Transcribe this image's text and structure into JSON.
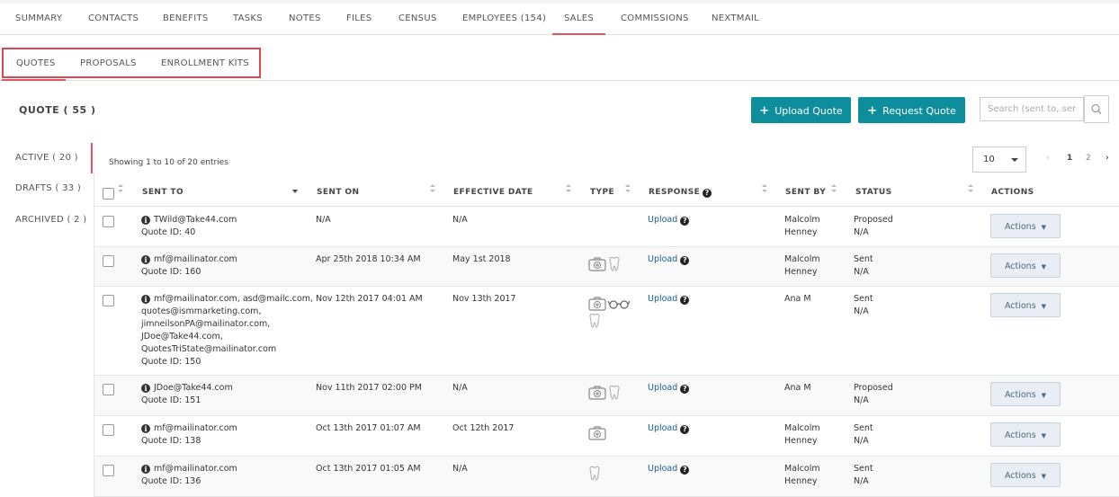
{
  "top_tabs": [
    {
      "label": "SUMMARY"
    },
    {
      "label": "CONTACTS"
    },
    {
      "label": "BENEFITS"
    },
    {
      "label": "TASKS"
    },
    {
      "label": "NOTES"
    },
    {
      "label": "FILES"
    },
    {
      "label": "CENSUS"
    },
    {
      "label": "EMPLOYEES (154)"
    },
    {
      "label": "SALES"
    },
    {
      "label": "COMMISSIONS"
    },
    {
      "label": "NEXTMAIL"
    }
  ],
  "sub_tabs": [
    {
      "label": "QUOTES"
    },
    {
      "label": "PROPOSALS"
    },
    {
      "label": "ENROLLMENT KITS"
    }
  ],
  "quote_title": "QUOTE ( 55 )",
  "upload_quote_label": "Upload Quote",
  "request_quote_label": "Request Quote",
  "search_placeholder": "Search (sent to, ser",
  "sidebar": [
    {
      "label": "ACTIVE ( 20 )"
    },
    {
      "label": "DRAFTS ( 33 )"
    },
    {
      "label": "ARCHIVED ( 2 )"
    }
  ],
  "showing_text": "Showing 1 to 10 of 20 entries",
  "page_size": "10",
  "pages": [
    "1",
    "2"
  ],
  "accent_color": "#0e8d9c",
  "columns": {
    "sent_to": "SENT TO",
    "sent_on": "SENT ON",
    "effective_date": "EFFECTIVE DATE",
    "type": "TYPE",
    "response": "RESPONSE",
    "sent_by": "SENT BY",
    "status": "STATUS",
    "actions": "ACTIONS"
  },
  "actions_label": "Actions",
  "rows": [
    {
      "sent_to": [
        "TWild@Take44.com"
      ],
      "quote_id": "Quote ID: 40",
      "sent_on": "N/A",
      "effective_date": "N/A",
      "type_icons": [],
      "response": "Upload",
      "sent_by": [
        "Malcolm",
        "Henney"
      ],
      "status": "Proposed",
      "status_sub": "N/A"
    },
    {
      "sent_to": [
        "mf@mailinator.com"
      ],
      "quote_id": "Quote ID: 160",
      "sent_on": "Apr 25th 2018 10:34 AM",
      "effective_date": "May 1st 2018",
      "type_icons": [
        "medical-icon",
        "dental-icon"
      ],
      "response": "Upload",
      "sent_by": [
        "Malcolm",
        "Henney"
      ],
      "status": "Sent",
      "status_sub": "N/A"
    },
    {
      "sent_to": [
        "mf@mailinator.com, asd@mailc.com,",
        "quotes@ismmarketing.com,",
        "jimneilsonPA@mailinator.com,",
        "JDoe@Take44.com,",
        "QuotesTriState@mailinator.com"
      ],
      "quote_id": "Quote ID: 150",
      "sent_on": "Nov 12th 2017 04:01 AM",
      "effective_date": "Nov 13th 2017",
      "type_icons": [
        "medical-icon",
        "vision-icon",
        "dental-icon"
      ],
      "response": "Upload",
      "sent_by": [
        "Ana M"
      ],
      "status": "Sent",
      "status_sub": "N/A"
    },
    {
      "sent_to": [
        "JDoe@Take44.com"
      ],
      "quote_id": "Quote ID: 151",
      "sent_on": "Nov 11th 2017 02:00 PM",
      "effective_date": "N/A",
      "type_icons": [
        "medical-icon",
        "dental-icon"
      ],
      "response": "Upload",
      "sent_by": [
        "Ana M"
      ],
      "status": "Proposed",
      "status_sub": "N/A"
    },
    {
      "sent_to": [
        "mf@mailinator.com"
      ],
      "quote_id": "Quote ID: 138",
      "sent_on": "Oct 13th 2017 01:07 AM",
      "effective_date": "Oct 12th 2017",
      "type_icons": [
        "medical-icon"
      ],
      "response": "Upload",
      "sent_by": [
        "Malcolm",
        "Henney"
      ],
      "status": "Sent",
      "status_sub": "N/A"
    },
    {
      "sent_to": [
        "mf@mailinator.com"
      ],
      "quote_id": "Quote ID: 136",
      "sent_on": "Oct 13th 2017 01:05 AM",
      "effective_date": "N/A",
      "type_icons": [
        "dental-icon"
      ],
      "response": "Upload",
      "sent_by": [
        "Malcolm",
        "Henney"
      ],
      "status": "Sent",
      "status_sub": "N/A"
    }
  ]
}
